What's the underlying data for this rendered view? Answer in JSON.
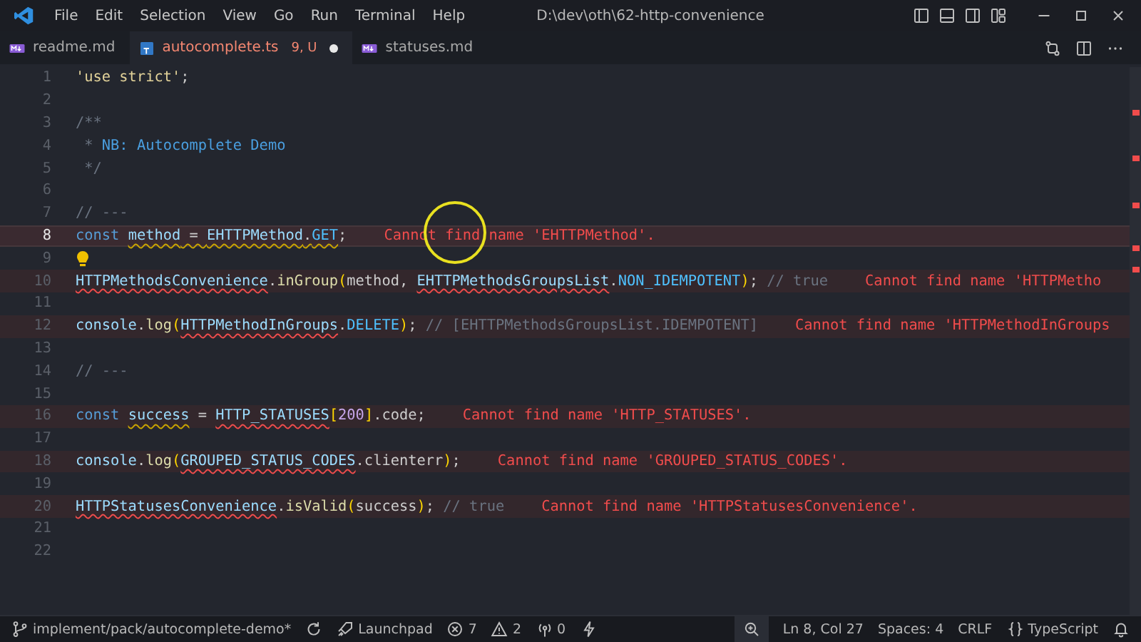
{
  "window": {
    "title": "D:\\dev\\oth\\62-http-convenience",
    "menu": [
      "File",
      "Edit",
      "Selection",
      "View",
      "Go",
      "Run",
      "Terminal",
      "Help"
    ]
  },
  "tabs": [
    {
      "kind": "md",
      "label": "readme.md",
      "selected": false,
      "modified": false
    },
    {
      "kind": "ts",
      "label": "autocomplete.ts",
      "problems": "9, U",
      "selected": true,
      "modified": true
    },
    {
      "kind": "md",
      "label": "statuses.md",
      "selected": false,
      "modified": false
    }
  ],
  "editor": {
    "lines": [
      {
        "number": "1",
        "tokens": [
          {
            "text": "'use strict'",
            "kind": "str"
          },
          {
            "text": ";",
            "kind": "punc"
          }
        ]
      },
      {
        "number": "2"
      },
      {
        "number": "3",
        "tokens": [
          {
            "text": "/**",
            "kind": "com"
          }
        ]
      },
      {
        "number": "4",
        "tokens": [
          {
            "text": " * ",
            "kind": "com"
          },
          {
            "text": "NB: Autocomplete Demo",
            "kind": "doc"
          }
        ]
      },
      {
        "number": "5",
        "tokens": [
          {
            "text": " */",
            "kind": "com"
          }
        ]
      },
      {
        "number": "6"
      },
      {
        "number": "7",
        "tokens": [
          {
            "text": "// ---",
            "kind": "com"
          }
        ]
      },
      {
        "number": "8",
        "current": true,
        "tokens": [
          {
            "text": "const ",
            "kind": "kw"
          },
          {
            "text": "method",
            "kind": "var",
            "warning": true
          },
          {
            "text": " = ",
            "kind": "punc",
            "warning": true
          },
          {
            "text": "EHTTPMethod",
            "kind": "var",
            "warning": true
          },
          {
            "text": ".",
            "kind": "punc",
            "warning": true
          },
          {
            "text": "GET",
            "kind": "const",
            "warning": true
          },
          {
            "text": ";",
            "kind": "punc"
          }
        ],
        "error": "Cannot find name 'EHTTPMethod'."
      },
      {
        "number": "9",
        "lightbulb": true
      },
      {
        "number": "10",
        "tokens": [
          {
            "text": "HTTPMethodsConvenience",
            "kind": "var",
            "error": true
          },
          {
            "text": ".",
            "kind": "punc"
          },
          {
            "text": "inGroup",
            "kind": "fn"
          },
          {
            "text": "(",
            "kind": "br"
          },
          {
            "text": "method, ",
            "kind": "plain"
          },
          {
            "text": "EHTTPMethodsGroupsList",
            "kind": "var",
            "error": true
          },
          {
            "text": ".",
            "kind": "punc"
          },
          {
            "text": "NON_IDEMPOTENT",
            "kind": "const"
          },
          {
            "text": ")",
            "kind": "br"
          },
          {
            "text": "; ",
            "kind": "punc"
          },
          {
            "text": "// true",
            "kind": "com"
          }
        ],
        "error": "Cannot find name 'HTTPMetho"
      },
      {
        "number": "11"
      },
      {
        "number": "12",
        "tokens": [
          {
            "text": "console",
            "kind": "var"
          },
          {
            "text": ".",
            "kind": "punc"
          },
          {
            "text": "log",
            "kind": "fn"
          },
          {
            "text": "(",
            "kind": "br"
          },
          {
            "text": "HTTPMethodInGroups",
            "kind": "var",
            "error": true
          },
          {
            "text": ".",
            "kind": "punc"
          },
          {
            "text": "DELETE",
            "kind": "const"
          },
          {
            "text": ")",
            "kind": "br"
          },
          {
            "text": "; ",
            "kind": "punc"
          },
          {
            "text": "// [EHTTPMethodsGroupsList.IDEMPOTENT]",
            "kind": "com"
          }
        ],
        "error": "Cannot find name 'HTTPMethodInGroups"
      },
      {
        "number": "13"
      },
      {
        "number": "14",
        "tokens": [
          {
            "text": "// ---",
            "kind": "com"
          }
        ]
      },
      {
        "number": "15"
      },
      {
        "number": "16",
        "tokens": [
          {
            "text": "const ",
            "kind": "kw"
          },
          {
            "text": "success",
            "kind": "var",
            "warning": true
          },
          {
            "text": " = ",
            "kind": "punc"
          },
          {
            "text": "HTTP_STATUSES",
            "kind": "var",
            "error": true
          },
          {
            "text": "[",
            "kind": "br"
          },
          {
            "text": "200",
            "kind": "num"
          },
          {
            "text": "]",
            "kind": "br"
          },
          {
            "text": ".code;",
            "kind": "plain"
          }
        ],
        "error": "Cannot find name 'HTTP_STATUSES'."
      },
      {
        "number": "17"
      },
      {
        "number": "18",
        "tokens": [
          {
            "text": "console",
            "kind": "var"
          },
          {
            "text": ".",
            "kind": "punc"
          },
          {
            "text": "log",
            "kind": "fn"
          },
          {
            "text": "(",
            "kind": "br"
          },
          {
            "text": "GROUPED_STATUS_CODES",
            "kind": "var",
            "error": true
          },
          {
            "text": ".clienterr",
            "kind": "plain"
          },
          {
            "text": ")",
            "kind": "br"
          },
          {
            "text": ";",
            "kind": "punc"
          }
        ],
        "error": "Cannot find name 'GROUPED_STATUS_CODES'."
      },
      {
        "number": "19"
      },
      {
        "number": "20",
        "tokens": [
          {
            "text": "HTTPStatusesConvenience",
            "kind": "var",
            "error": true
          },
          {
            "text": ".",
            "kind": "punc"
          },
          {
            "text": "isValid",
            "kind": "fn"
          },
          {
            "text": "(",
            "kind": "br"
          },
          {
            "text": "success",
            "kind": "plain"
          },
          {
            "text": ")",
            "kind": "br"
          },
          {
            "text": "; ",
            "kind": "punc"
          },
          {
            "text": "// true",
            "kind": "com"
          }
        ],
        "error": "Cannot find name 'HTTPStatusesConvenience'."
      },
      {
        "number": "21"
      },
      {
        "number": "22"
      }
    ]
  },
  "status_bar": {
    "left": [
      {
        "kind": "branch",
        "text": "implement/pack/autocomplete-demo*"
      },
      {
        "kind": "sync"
      },
      {
        "kind": "launchpad",
        "text": "Launchpad"
      },
      {
        "kind": "errors",
        "text": "7"
      },
      {
        "kind": "warnings",
        "text": "2"
      },
      {
        "kind": "ports",
        "text": "0"
      },
      {
        "kind": "lightning"
      }
    ],
    "right": [
      {
        "kind": "zoom"
      },
      {
        "kind": "text",
        "text": "Ln 8, Col 27"
      },
      {
        "kind": "text",
        "text": "Spaces: 4"
      },
      {
        "kind": "text",
        "text": "CRLF"
      },
      {
        "kind": "language",
        "text": "TypeScript"
      },
      {
        "kind": "bell"
      }
    ]
  }
}
